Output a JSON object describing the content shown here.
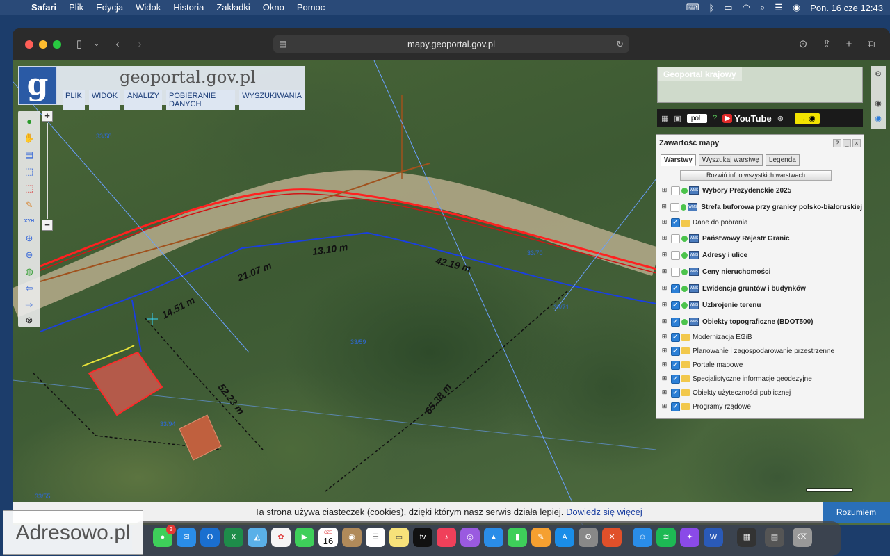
{
  "menubar": {
    "app": "Safari",
    "items": [
      "Plik",
      "Edycja",
      "Widok",
      "Historia",
      "Zakładki",
      "Okno",
      "Pomoc"
    ],
    "datetime": "Pon. 16 cze  12:43"
  },
  "browser": {
    "url": "mapy.geoportal.gov.pl"
  },
  "geoportal": {
    "logo_letter": "g",
    "title": "geoportal.gov.pl",
    "menu": [
      "PLIK",
      "WIDOK",
      "ANALIZY",
      "POBIERANIE DANYCH",
      "WYSZUKIWANIA"
    ],
    "overview_title": "Geoportal krajowy",
    "language": "pol",
    "youtube": "YouTube"
  },
  "panel": {
    "title": "Zawartość mapy",
    "tabs": [
      "Warstwy",
      "Wyszukaj warstwę",
      "Legenda"
    ],
    "expand_button": "Rozwiń inf. o wszystkich warstwach",
    "layers": [
      {
        "name": "Wybory Prezydenckie 2025",
        "checked": false,
        "type": "wms",
        "bold": true
      },
      {
        "name": "Strefa buforowa przy granicy polsko-białoruskiej",
        "checked": false,
        "type": "wms",
        "bold": true
      },
      {
        "name": "Dane do pobrania",
        "checked": true,
        "type": "folder",
        "bold": false
      },
      {
        "name": "Państwowy Rejestr Granic",
        "checked": false,
        "type": "wms",
        "bold": true
      },
      {
        "name": "Adresy i ulice",
        "checked": false,
        "type": "wms",
        "bold": true
      },
      {
        "name": "Ceny nieruchomości",
        "checked": false,
        "type": "wms",
        "bold": true
      },
      {
        "name": "Ewidencja gruntów i budynków",
        "checked": true,
        "type": "wms",
        "bold": true
      },
      {
        "name": "Uzbrojenie terenu",
        "checked": true,
        "type": "wms",
        "bold": true
      },
      {
        "name": "Obiekty topograficzne (BDOT500)",
        "checked": true,
        "type": "wms",
        "bold": true
      },
      {
        "name": "Modernizacja EGiB",
        "checked": true,
        "type": "folder",
        "bold": false
      },
      {
        "name": "Planowanie i zagospodarowanie przestrzenne",
        "checked": true,
        "type": "folder",
        "bold": false
      },
      {
        "name": "Portale mapowe",
        "checked": true,
        "type": "folder",
        "bold": false
      },
      {
        "name": "Specjalistyczne informacje geodezyjne",
        "checked": true,
        "type": "folder",
        "bold": false
      },
      {
        "name": "Obiekty użyteczności publicznej",
        "checked": true,
        "type": "folder",
        "bold": false
      },
      {
        "name": "Programy rządowe",
        "checked": true,
        "type": "folder",
        "bold": false
      }
    ]
  },
  "map": {
    "measurements": [
      "14.51 m",
      "21.07 m",
      "13.10 m",
      "42.19 m",
      "52.23 m",
      "65.38 m"
    ],
    "parcels": [
      "33/58",
      "33/70",
      "33/71",
      "33/59",
      "33/94",
      "33/55"
    ]
  },
  "cookie": {
    "text": "Ta strona używa ciasteczek (cookies), dzięki którym nasz serwis działa lepiej.",
    "link": "Dowiedz się więcej",
    "button": "Rozumiem"
  },
  "dock": {
    "calendar_month": "CZE",
    "calendar_day": "16",
    "messages_badge": "2"
  },
  "watermark": "Adresowo.pl"
}
